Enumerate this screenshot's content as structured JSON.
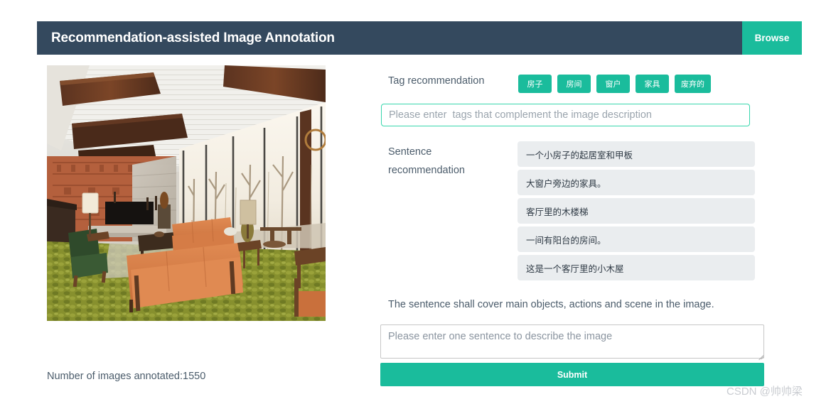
{
  "header": {
    "title": "Recommendation-assisted Image Annotation",
    "browse_label": "Browse",
    "bar_color": "#34495e",
    "accent_color": "#1abc9c"
  },
  "left_panel": {
    "image_alt": "living-room-photo",
    "count_text": "Number of images annotated:1550"
  },
  "tag_section": {
    "label": "Tag recommendation",
    "chips": [
      "房子",
      "房间",
      "窗户",
      "家具",
      "废弃的"
    ],
    "input_value": "",
    "input_placeholder": "Please enter  tags that complement the image description",
    "input_border_color": "#36d6ac"
  },
  "sentence_section": {
    "label": "Sentence recommendation",
    "rows": [
      "一个小房子的起居室和甲板",
      "大窗户旁边的家具。",
      "客厅里的木楼梯",
      "一间有阳台的房间。",
      "这是一个客厅里的小木屋"
    ],
    "row_bg": "#eaedef"
  },
  "compose_section": {
    "hint": "The sentence shall cover main objects, actions and scene in the image.",
    "textarea_value": "",
    "textarea_placeholder": "Please enter one sentence to describe the image",
    "submit_label": "Submit"
  },
  "watermark": {
    "text": "CSDN @帅帅梁"
  }
}
